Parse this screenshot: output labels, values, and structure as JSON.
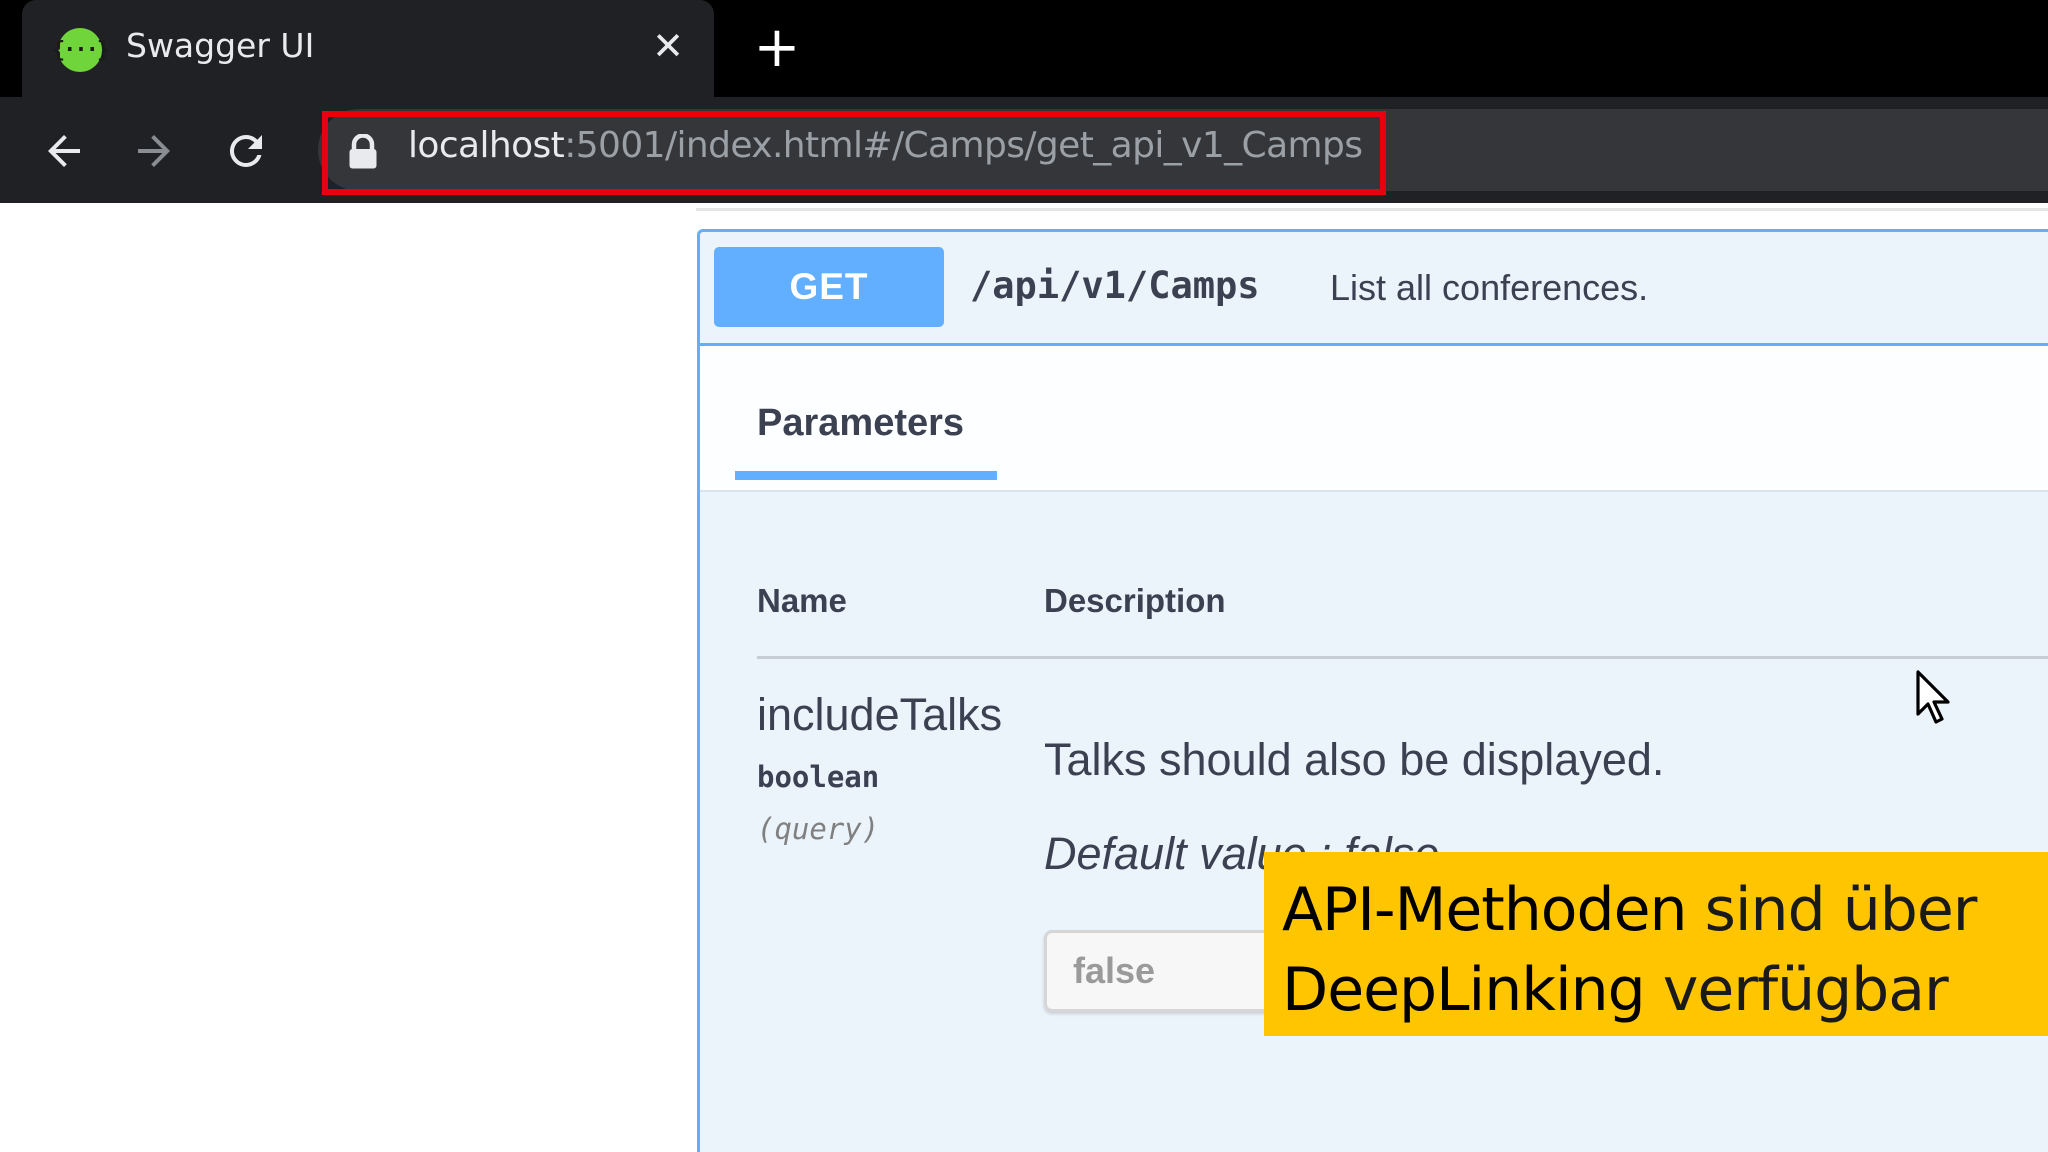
{
  "browser": {
    "tab": {
      "favicon_glyph": "{···}",
      "title": "Swagger UI",
      "close_glyph": "✕"
    },
    "new_tab_glyph": "+",
    "address_bar": {
      "host": "localhost",
      "path": ":5001/index.html#/Camps/get_api_v1_Camps",
      "highlight_color": "#e8000f"
    }
  },
  "operation": {
    "method": "GET",
    "path": "/api/v1/Camps",
    "summary": "List all conferences.",
    "method_color": "#61affe",
    "tabs": [
      {
        "label": "Parameters",
        "active": true
      }
    ],
    "columns": {
      "name": "Name",
      "description": "Description"
    },
    "parameters": [
      {
        "name": "includeTalks",
        "type": "boolean",
        "in": "(query)",
        "description": "Talks should also be displayed.",
        "default_text": "Default value : false",
        "selected_value": "false"
      }
    ]
  },
  "caption": {
    "line1_bold": "API-Methoden",
    "line1_rest": " sind über",
    "line2_bold": "DeepLinking",
    "line2_rest": " verfügbar",
    "background": "#ffc600"
  }
}
